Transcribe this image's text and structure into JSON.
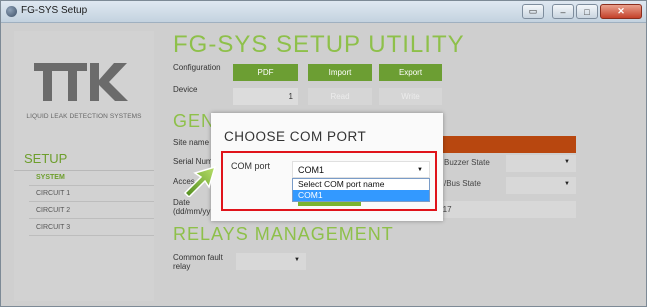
{
  "window": {
    "title": "FG-SYS Setup"
  },
  "brand": {
    "logo_text": "TTK",
    "tagline": "LIQUID LEAK DETECTION SYSTEMS"
  },
  "sidebar": {
    "heading": "SETUP",
    "items": [
      {
        "label": "SYSTEM",
        "active": true
      },
      {
        "label": "CIRCUIT 1",
        "active": false
      },
      {
        "label": "CIRCUIT 2",
        "active": false
      },
      {
        "label": "CIRCUIT 3",
        "active": false
      }
    ]
  },
  "main": {
    "title": "FG-SYS SETUP UTILITY",
    "configuration_label": "Configuration",
    "device_label": "Device",
    "device_value": "1",
    "buttons": {
      "pdf": "PDF",
      "import": "Import",
      "export": "Export",
      "read": "Read",
      "write": "Write"
    },
    "general_title": "GENERAL",
    "site_name_label": "Site name",
    "serial_label": "Serial Num",
    "access_label": "Acces",
    "date_label": "Date",
    "date_format_label": "(dd/mm/yy",
    "buzzer_label": "Buzzer State",
    "bus_label": "/Bus State",
    "time_value": "6:17",
    "relays_title": "RELAYS MANAGEMENT",
    "common_fault_label": "Common fault",
    "relay_label": "relay"
  },
  "dialog": {
    "title": "CHOOSE COM PORT",
    "com_label": "COM port",
    "selected_value": "COM1",
    "options": [
      {
        "label": "Select COM port name",
        "highlighted": false
      },
      {
        "label": "COM1",
        "highlighted": true
      }
    ]
  },
  "colors": {
    "accent_green": "#8ec04a",
    "button_green": "#6c9e33",
    "highlight_red": "#e0141b",
    "field_orange": "#b8470f",
    "select_blue": "#3399ff"
  }
}
